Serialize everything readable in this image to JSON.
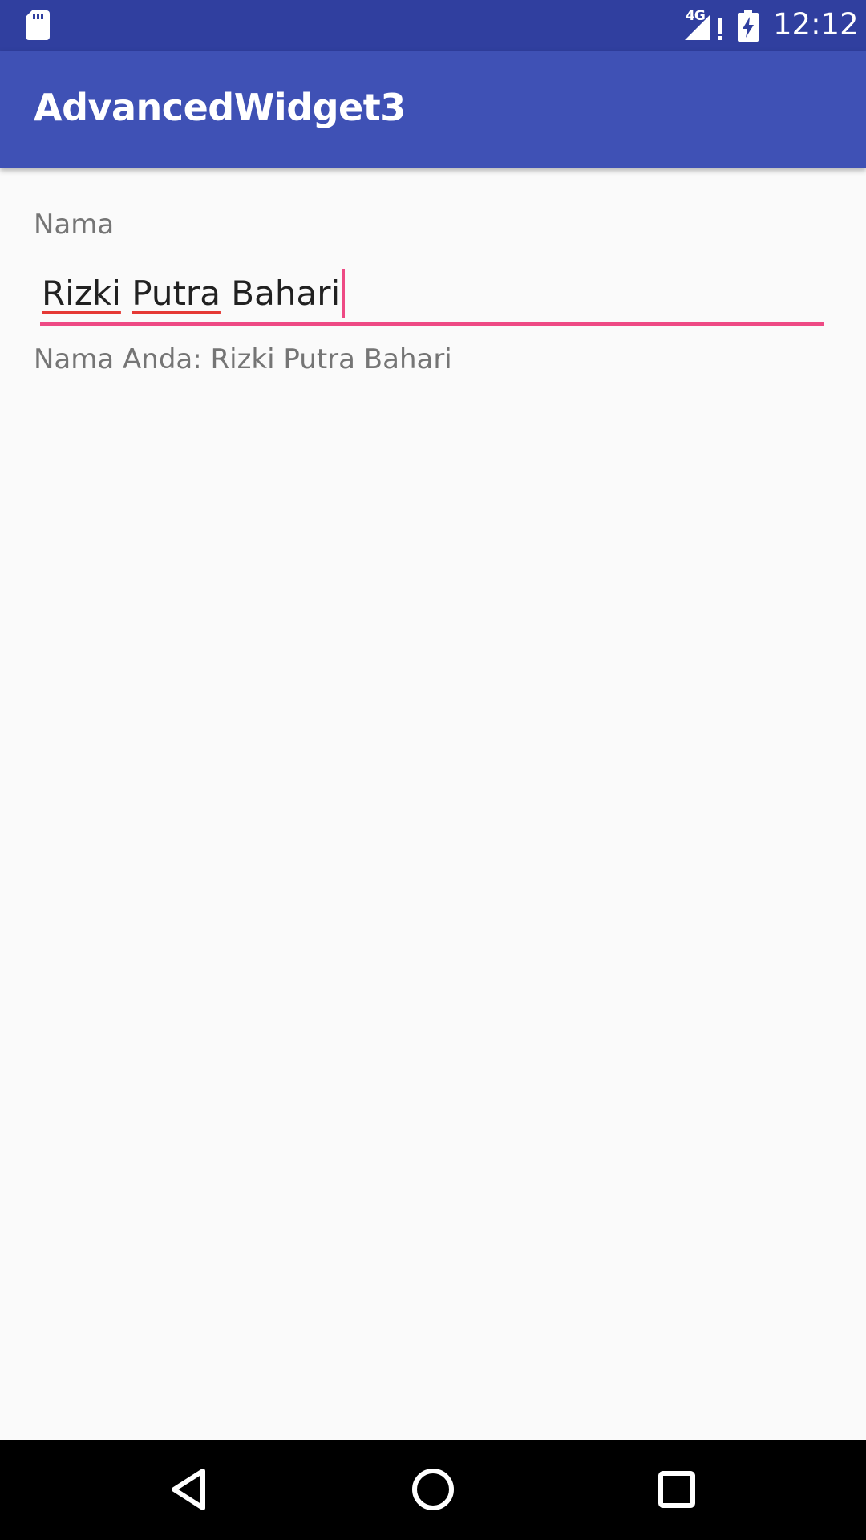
{
  "status_bar": {
    "sd_icon": "sd-card-icon",
    "network_type": "4G",
    "signal_icon": "signal-alert-icon",
    "battery_icon": "battery-charging-icon",
    "time": "12:12",
    "background_color": "#303f9f"
  },
  "app_bar": {
    "title": "AdvancedWidget3",
    "background_color": "#3f51b5"
  },
  "form": {
    "name_label": "Nama",
    "name_value": "Rizki Putra Bahari",
    "name_words": [
      "Rizki",
      "Putra",
      "Bahari"
    ],
    "result_text": "Nama Anda: Rizki Putra Bahari",
    "accent_color": "#ee4a84",
    "spellcheck_color": "#e53935"
  },
  "nav_bar": {
    "back_icon": "back-triangle-icon",
    "home_icon": "home-circle-icon",
    "recents_icon": "recents-square-icon"
  }
}
